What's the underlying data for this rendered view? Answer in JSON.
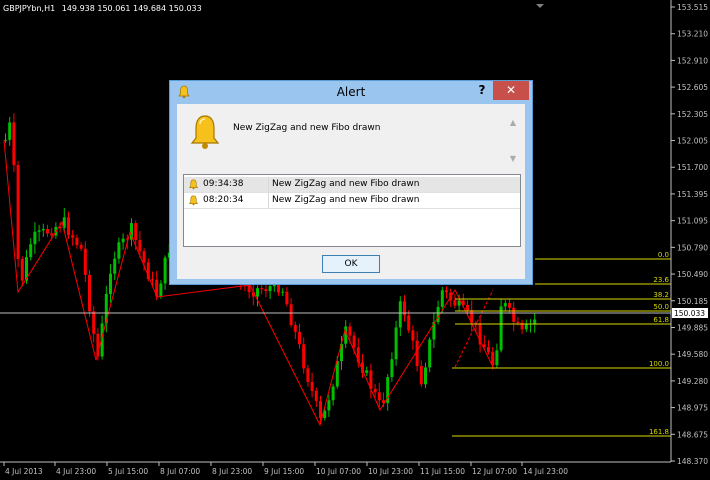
{
  "chart": {
    "symbol": "GBPJPYbn,H1",
    "ohlc": "149.938 150.061 149.684 150.033",
    "current_price_label": "150.033",
    "colors": {
      "background": "#000000",
      "bull": "#00c000",
      "bear": "#ff0000",
      "fibo": "#d8d800",
      "axis_text": "#c0c0c0"
    },
    "price_axis": [
      "153.515",
      "153.210",
      "152.910",
      "152.605",
      "152.305",
      "152.005",
      "151.700",
      "151.395",
      "151.095",
      "150.790",
      "150.490",
      "150.185",
      "149.885",
      "149.580",
      "149.280",
      "148.975",
      "148.675",
      "148.370"
    ],
    "time_axis": [
      "4 Jul 2013",
      "4 Jul 23:00",
      "5 Jul 15:00",
      "8 Jul 07:00",
      "8 Jul 23:00",
      "9 Jul 15:00",
      "10 Jul 07:00",
      "10 Jul 23:00",
      "11 Jul 15:00",
      "12 Jul 07:00",
      "14 Jul 23:00"
    ],
    "fibo_levels": [
      "0.0",
      "23.6",
      "38.2",
      "50.0",
      "61.8",
      "100.0",
      "161.8"
    ]
  },
  "alert": {
    "title": "Alert",
    "help_label": "?",
    "close_label": "✕",
    "message": "New ZigZag and new Fibo drawn",
    "rows": [
      {
        "time": "09:34:38",
        "message": "New ZigZag and new Fibo drawn"
      },
      {
        "time": "08:20:34",
        "message": "New ZigZag and new Fibo drawn"
      }
    ],
    "ok_label": "OK"
  },
  "icons": {
    "title": "bell-icon",
    "message": "bell-icon",
    "row": "bell-icon"
  }
}
